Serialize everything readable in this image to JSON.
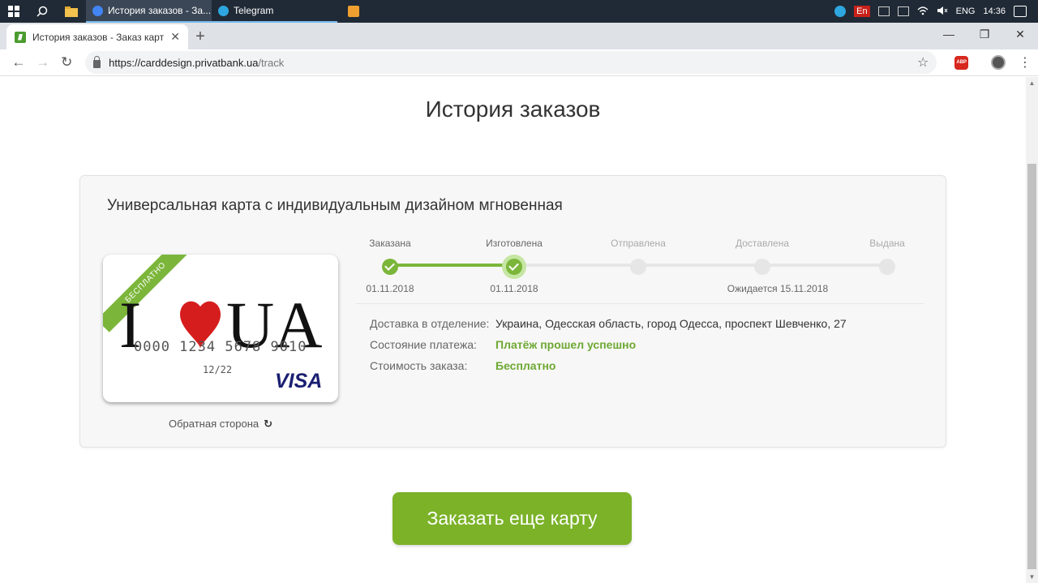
{
  "taskbar": {
    "apps": [
      {
        "label": "История заказов - За...",
        "color": "#4285f4",
        "active": true
      },
      {
        "label": "Telegram",
        "color": "#2ea6df",
        "active": false
      }
    ],
    "tray_lang_badge": "En",
    "keyboard_lang": "ENG",
    "time": "14:36"
  },
  "browser": {
    "tab_title": "История заказов - Заказ карт",
    "url_host": "https://carddesign.privatbank.ua",
    "url_path": "/track",
    "abp_label": "ABP"
  },
  "page": {
    "title": "История заказов",
    "order": {
      "product_name": "Универсальная карта с индивидуальным дизайном мгновенная",
      "card_ribbon": "БЕСПЛАТНО",
      "card_text_left": "I",
      "card_text_right": "UA",
      "card_number": "0000 1234 5678 9010",
      "card_expiry": "12/22",
      "card_brand": "VISA",
      "flip_label": "Обратная сторона",
      "steps": [
        {
          "label": "Заказана",
          "date": "01.11.2018",
          "status": "done"
        },
        {
          "label": "Изготовлена",
          "date": "01.11.2018",
          "status": "current"
        },
        {
          "label": "Отправлена",
          "date": "",
          "status": "pending"
        },
        {
          "label": "Доставлена",
          "date": "",
          "status": "pending"
        },
        {
          "label": "Выдана",
          "date": "",
          "status": "pending"
        }
      ],
      "expected_text": "Ожидается 15.11.2018",
      "details": {
        "delivery_label": "Доставка в отделение:",
        "delivery_value": "Украина, Одесская область, город Одесса, проспект Шевченко, 27",
        "payment_label": "Состояние платежа:",
        "payment_value": "Платёж прошел успешно",
        "cost_label": "Стоимость заказа:",
        "cost_value": "Бесплатно"
      }
    },
    "order_more_button": "Заказать еще карту"
  },
  "colors": {
    "accent_green": "#7bb228",
    "status_green": "#6ea832",
    "visa_blue": "#1a1f71"
  }
}
